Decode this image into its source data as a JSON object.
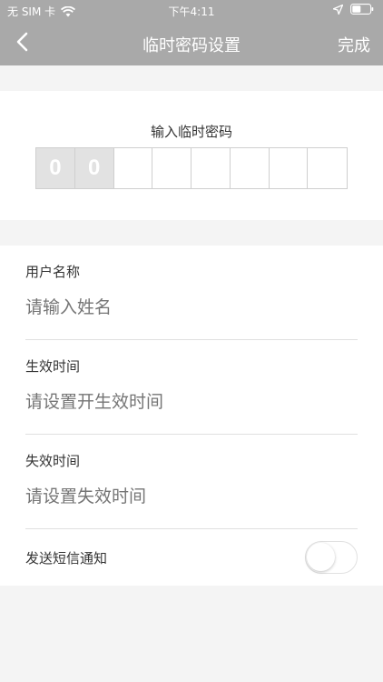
{
  "status_bar": {
    "carrier": "无 SIM 卡",
    "time": "下午4:11"
  },
  "nav": {
    "title": "临时密码设置",
    "done_label": "完成"
  },
  "password": {
    "label": "输入临时密码",
    "digits": [
      "0",
      "0",
      "",
      "",
      "",
      "",
      "",
      ""
    ]
  },
  "form": {
    "name_label": "用户名称",
    "name_placeholder": "请输入姓名",
    "start_label": "生效时间",
    "start_placeholder": "请设置开生效时间",
    "end_label": "失效时间",
    "end_placeholder": "请设置失效时间",
    "sms_label": "发送短信通知",
    "sms_enabled": false
  },
  "colors": {
    "nav_bg": "#a9a9a9",
    "page_bg": "#f4f4f4",
    "placeholder": "#c8c8c8"
  }
}
